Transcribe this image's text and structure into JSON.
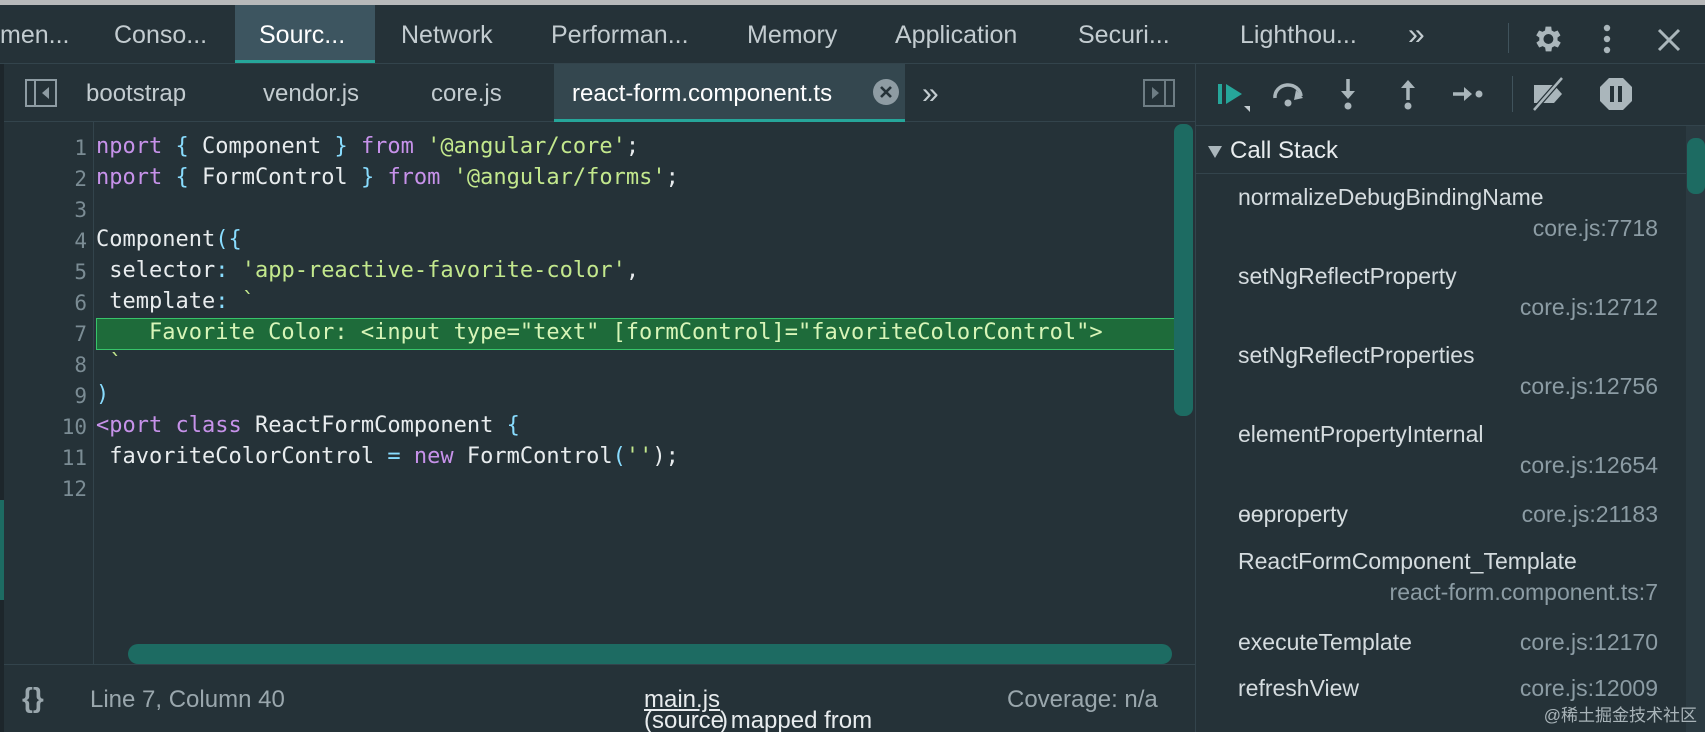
{
  "top_tabs": [
    {
      "label": "men..."
    },
    {
      "label": "Conso..."
    },
    {
      "label": "Sourc..."
    },
    {
      "label": "Network"
    },
    {
      "label": "Performan..."
    },
    {
      "label": "Memory"
    },
    {
      "label": "Application"
    },
    {
      "label": "Securi..."
    },
    {
      "label": "Lighthou..."
    }
  ],
  "top_more": "»",
  "file_tabs": [
    {
      "label": "bootstrap"
    },
    {
      "label": "vendor.js"
    },
    {
      "label": "core.js"
    },
    {
      "label": "react-form.component.ts"
    }
  ],
  "file_more": "»",
  "code": {
    "line_numbers": [
      "1",
      "2",
      "3",
      "4",
      "5",
      "6",
      "7",
      "8",
      "9",
      "10",
      "11",
      "12"
    ],
    "l1": {
      "a": "nport ",
      "b": "{ ",
      "c": "Component ",
      "d": "} ",
      "e": "from ",
      "f": "'@angular/core'",
      "g": ";"
    },
    "l2": {
      "a": "nport ",
      "b": "{ ",
      "c": "FormControl ",
      "d": "} ",
      "e": "from ",
      "f": "'@angular/forms'",
      "g": ";"
    },
    "l4": {
      "a": "Component",
      "b": "({"
    },
    "l5": {
      "a": " selector",
      "b": ": ",
      "c": "'app-reactive-favorite-color'",
      "d": ","
    },
    "l6": {
      "a": " template",
      "b": ": ",
      "c": "`"
    },
    "l7": "    Favorite Color: <input type=\"text\" [formControl]=\"favoriteColorControl\">",
    "l8": " `",
    "l9": ")",
    "l10": {
      "a": "<port ",
      "b": "class ",
      "c": "ReactFormComponent ",
      "d": "{"
    },
    "l11": {
      "a": " favoriteColorControl ",
      "b": "= ",
      "c": "new ",
      "d": "FormControl",
      "e": "(",
      "f": "''",
      "g": ");"
    }
  },
  "status": {
    "braces": "{}",
    "position": "Line 7, Column 40",
    "mapped_prefix": "(source mapped from ",
    "mapped_file": "main.js",
    "mapped_suffix": ")",
    "coverage": "Coverage: n/a"
  },
  "call_stack": {
    "title": "Call Stack",
    "frames": [
      {
        "name": "normalizeDebugBindingName",
        "loc": "core.js:7718"
      },
      {
        "name": "setNgReflectProperty",
        "loc": "core.js:12712"
      },
      {
        "name": "setNgReflectProperties",
        "loc": "core.js:12756"
      },
      {
        "name": "elementPropertyInternal",
        "loc": "core.js:12654"
      },
      {
        "name": "ɵɵproperty",
        "loc": "core.js:21183"
      },
      {
        "name": "ReactFormComponent_Template",
        "loc": "react-form.component.ts:7"
      },
      {
        "name": "executeTemplate",
        "loc": "core.js:12170"
      },
      {
        "name": "refreshView",
        "loc": "core.js:12009"
      }
    ]
  },
  "watermark": "@稀土掘金技术社区",
  "colors": {
    "accent": "#26a69a",
    "keyword": "#c792ea",
    "string": "#c3e88d",
    "highlight": "#1e6b3a"
  }
}
